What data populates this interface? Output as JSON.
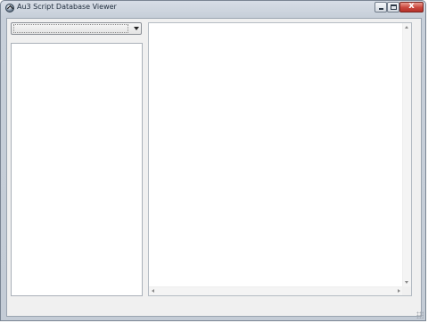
{
  "window": {
    "title": "Au3 Script Database Viewer",
    "close_label": "x",
    "app_icon": "autoit-icon"
  },
  "toolbar": {
    "combo_value": ""
  },
  "colors": {
    "titlebar": "#c7cfd9",
    "client_background": "#f0f0f0",
    "close_button": "#c9473d",
    "pane_background": "#ffffff"
  }
}
